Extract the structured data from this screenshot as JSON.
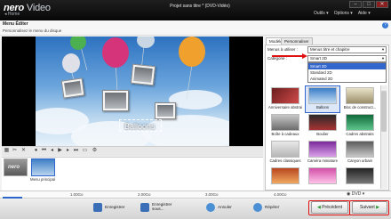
{
  "app": {
    "logo_brand": "nero",
    "logo_product": "Video",
    "home_label": "Home",
    "window_title": "Projet sans titre * (DVD-Vidéo)",
    "menus": [
      "Outils ▾",
      "Options ▾",
      "Aide ▾"
    ]
  },
  "page": {
    "title": "Menu Éditer",
    "subtitle": "Personnalisez le menu du disque"
  },
  "preview": {
    "caption": "Balloons"
  },
  "timeline": {
    "items": [
      {
        "label": ""
      },
      {
        "label": "Menu principal"
      }
    ]
  },
  "right": {
    "tabs": [
      "Modèles",
      "Personnaliser"
    ],
    "menu_label": "Menus à utiliser :",
    "menu_value": "Menus titre et chapitre",
    "category_label": "Catégorie :",
    "category_value": "Smart 2D",
    "category_options": [
      "Smart 2D",
      "Standard 2D",
      "Animated 2D"
    ],
    "gallery": [
      {
        "label": "Anniversaire abstraits"
      },
      {
        "label": "Ballons"
      },
      {
        "label": "Bloc de construct..."
      },
      {
        "label": "Boîte à cadeaux"
      },
      {
        "label": "Boulier"
      },
      {
        "label": "Cadres abstraits"
      },
      {
        "label": "Cadres classiques"
      },
      {
        "label": "Caméra miniature"
      },
      {
        "label": "Canyon urbain"
      },
      {
        "label": ""
      },
      {
        "label": ""
      },
      {
        "label": ""
      }
    ]
  },
  "ruler": {
    "ticks": [
      "1.00Go",
      "2.00Go",
      "3.00Go",
      "4.00Go"
    ],
    "disc_type": "DVD"
  },
  "bottom": {
    "save": "Enregistrer",
    "save_as": "Enregistrer sous...",
    "undo": "Annuler",
    "redo": "Répéter",
    "previous": "Précédent",
    "next": "Suivant"
  },
  "colors": {
    "accent": "#3366cc",
    "highlight": "#e01010"
  }
}
